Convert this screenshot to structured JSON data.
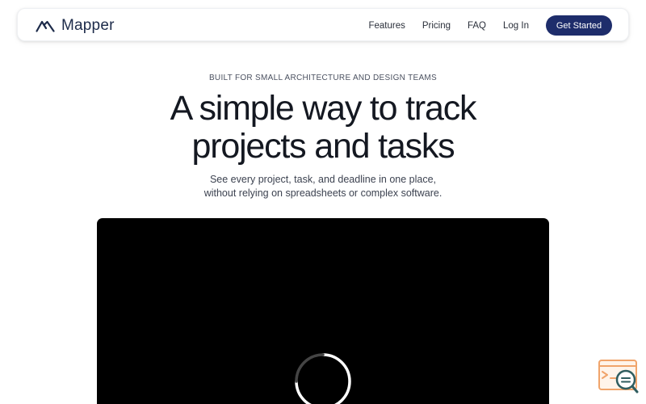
{
  "brand": {
    "name": "Mapper",
    "logo_icon": "mountain-logo-icon"
  },
  "nav": {
    "links": [
      "Features",
      "Pricing",
      "FAQ",
      "Log In"
    ],
    "cta_label": "Get Started"
  },
  "hero": {
    "eyebrow": "BUILT FOR SMALL ARCHITECTURE AND DESIGN TEAMS",
    "headline_line1": "A simple way to track",
    "headline_line2": "projects and tasks",
    "subhead_line1": "See every project, task, and deadline in one place,",
    "subhead_line2": "without relying on spreadsheets or complex software."
  },
  "video": {
    "state_icon": "loading-spinner-icon"
  },
  "widget": {
    "icon": "feedback-search-icon"
  },
  "colors": {
    "accent": "#1e2d6b",
    "brand_text": "#1d2b4a",
    "video_bg": "#000000",
    "widget_orange": "#f0a46b",
    "widget_teal": "#2f5d5f"
  }
}
